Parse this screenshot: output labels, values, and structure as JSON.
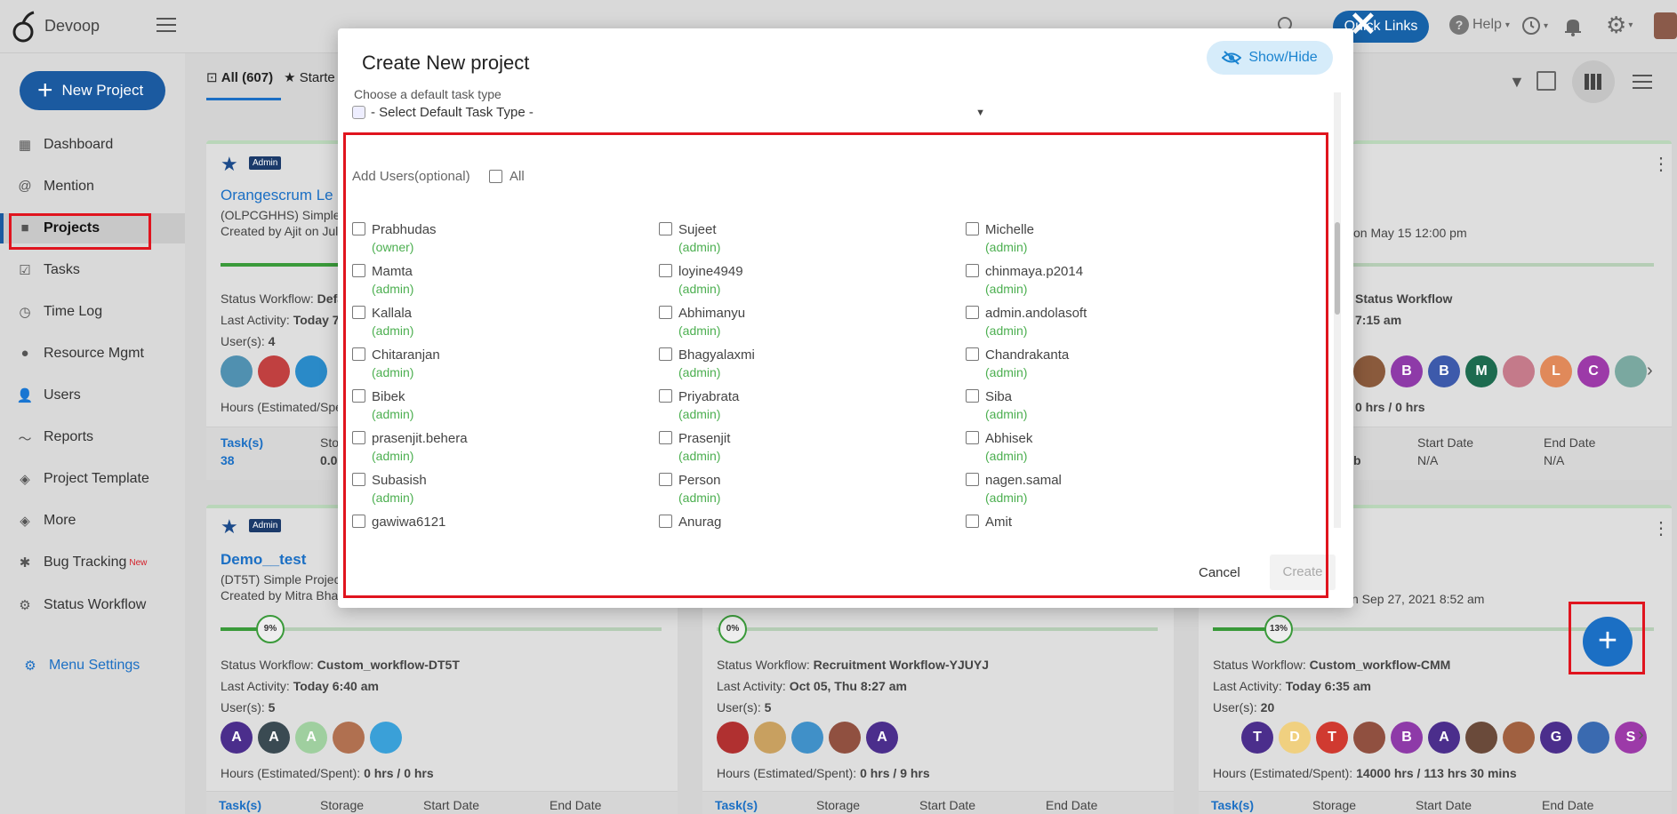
{
  "app": {
    "brand": "Devoop"
  },
  "topbar": {
    "quick_links": "Quick Links",
    "help": "Help"
  },
  "sidebar": {
    "new_project": "New Project",
    "items": [
      {
        "label": "Dashboard",
        "icon": "dashboard-icon"
      },
      {
        "label": "Mention",
        "icon": "at-icon"
      },
      {
        "label": "Projects",
        "icon": "briefcase-icon"
      },
      {
        "label": "Tasks",
        "icon": "clipboard-icon"
      },
      {
        "label": "Time Log",
        "icon": "clock-icon"
      },
      {
        "label": "Resource Mgmt",
        "icon": "resource-icon"
      },
      {
        "label": "Users",
        "icon": "user-icon"
      },
      {
        "label": "Reports",
        "icon": "chart-line-icon"
      },
      {
        "label": "Project Template",
        "icon": "layers-icon"
      },
      {
        "label": "More",
        "icon": "layers-icon"
      },
      {
        "label": "Bug Tracking",
        "icon": "bug-icon",
        "badge": "New"
      },
      {
        "label": "Status Workflow",
        "icon": "workflow-icon"
      }
    ],
    "menu_settings": "Menu Settings"
  },
  "content": {
    "tab_all": "All (607)",
    "tab_starred": "Starte"
  },
  "cards": {
    "card1": {
      "badge": "Admin",
      "title": "Orangescrum Le",
      "sub": "(OLPCGHHS) Simple",
      "created": "Created by Ajit on Jul",
      "workflow_label": "Status Workflow:",
      "workflow": "Defa",
      "activity_label": "Last Activity:",
      "activity": "Today 7",
      "users_label": "User(s):",
      "users": "4",
      "hours_label": "Hours (Estimated/Spe",
      "tasks_label": "Task(s)",
      "tasks": "38",
      "storage_label": "Sto",
      "storage": "0.0"
    },
    "card3": {
      "created": "on May 15 12:00 pm",
      "workflow": "Status Workflow",
      "activity": "7:15 am",
      "hours": "0 hrs / 0 hrs",
      "storage": "b",
      "start_label": "Start Date",
      "start": "N/A",
      "end_label": "End Date",
      "end": "N/A"
    },
    "card4": {
      "badge": "Admin",
      "title": "Demo__test",
      "sub": "(DT5T) Simple Projec",
      "created": "Created by Mitra Bhar",
      "progress": "9%",
      "workflow_label": "Status Workflow:",
      "workflow": "Custom_workflow-DT5T",
      "activity_label": "Last Activity:",
      "activity": "Today 6:40 am",
      "users_label": "User(s):",
      "users": "5",
      "hours_label": "Hours (Estimated/Spent):",
      "hours": "0 hrs / 0 hrs",
      "tasks_label": "Task(s)",
      "storage_label": "Storage",
      "start_label": "Start Date",
      "end_label": "End Date"
    },
    "card5": {
      "progress": "0%",
      "workflow_label": "Status Workflow:",
      "workflow": "Recruitment Workflow-YJUYJ",
      "activity_label": "Last Activity:",
      "activity": "Oct 05, Thu 8:27 am",
      "users_label": "User(s):",
      "users": "5",
      "hours_label": "Hours (Estimated/Spent):",
      "hours": "0 hrs / 9 hrs",
      "tasks_label": "Task(s)",
      "storage_label": "Storage",
      "start_label": "Start Date",
      "end_label": "End Date"
    },
    "card6": {
      "created": "n Sep 27, 2021 8:52 am",
      "progress": "13%",
      "workflow_label": "Status Workflow:",
      "workflow": "Custom_workflow-CMM",
      "activity_label": "Last Activity:",
      "activity": "Today 6:35 am",
      "users_label": "User(s):",
      "users": "20",
      "hours_label": "Hours (Estimated/Spent):",
      "hours": "14000 hrs / 113 hrs 30 mins",
      "tasks_label": "Task(s)",
      "storage_label": "Storage",
      "start_label": "Start Date",
      "end_label": "End Date"
    }
  },
  "modal": {
    "title": "Create New project",
    "show_hide": "Show/Hide",
    "task_type_label": "Choose a default task type",
    "task_type_select": "- Select Default Task Type -",
    "add_users": "Add Users(optional)",
    "all": "All",
    "users": [
      {
        "name": "Prabhudas",
        "role": "(owner)"
      },
      {
        "name": "Sujeet",
        "role": "(admin)"
      },
      {
        "name": "Michelle",
        "role": "(admin)"
      },
      {
        "name": "Mamta",
        "role": "(admin)"
      },
      {
        "name": "loyine4949",
        "role": "(admin)"
      },
      {
        "name": "chinmaya.p2014",
        "role": "(admin)"
      },
      {
        "name": "Kallala",
        "role": "(admin)"
      },
      {
        "name": "Abhimanyu",
        "role": "(admin)"
      },
      {
        "name": "admin.andolasoft",
        "role": "(admin)"
      },
      {
        "name": "Chitaranjan",
        "role": "(admin)"
      },
      {
        "name": "Bhagyalaxmi",
        "role": "(admin)"
      },
      {
        "name": "Chandrakanta",
        "role": "(admin)"
      },
      {
        "name": "Bibek",
        "role": "(admin)"
      },
      {
        "name": "Priyabrata",
        "role": "(admin)"
      },
      {
        "name": "Siba",
        "role": "(admin)"
      },
      {
        "name": "prasenjit.behera",
        "role": "(admin)"
      },
      {
        "name": "Prasenjit",
        "role": "(admin)"
      },
      {
        "name": "Abhisek",
        "role": "(admin)"
      },
      {
        "name": "Subasish",
        "role": "(admin)"
      },
      {
        "name": "Person",
        "role": "(admin)"
      },
      {
        "name": "nagen.samal",
        "role": "(admin)"
      },
      {
        "name": "gawiwa6121",
        "role": ""
      },
      {
        "name": "Anurag",
        "role": ""
      },
      {
        "name": "Amit",
        "role": ""
      }
    ],
    "cancel": "Cancel",
    "create": "Create"
  },
  "avatars": {
    "card3": [
      {
        "letter": "",
        "color": "#8a5a3c"
      },
      {
        "letter": "B",
        "color": "#8e3aa8"
      },
      {
        "letter": "B",
        "color": "#3d5aab"
      },
      {
        "letter": "M",
        "color": "#1d6b4f"
      },
      {
        "letter": "",
        "color": "#c47a8a"
      },
      {
        "letter": "L",
        "color": "#e0895a"
      },
      {
        "letter": "C",
        "color": "#9c3aa8"
      },
      {
        "letter": "",
        "color": "#7aa8a0"
      }
    ],
    "card4": [
      {
        "letter": "A",
        "color": "#4b2e8c"
      },
      {
        "letter": "A",
        "color": "#3a4a52"
      },
      {
        "letter": "A",
        "color": "#9fcf9f"
      },
      {
        "letter": "",
        "color": "#b07050"
      },
      {
        "letter": "",
        "color": "#3aa0d8"
      }
    ],
    "card5": [
      {
        "letter": "",
        "color": "#b03030"
      },
      {
        "letter": "",
        "color": "#c8a060"
      },
      {
        "letter": "",
        "color": "#4090c8"
      },
      {
        "letter": "",
        "color": "#905040"
      },
      {
        "letter": "A",
        "color": "#4b2e8c"
      }
    ],
    "card6": [
      {
        "letter": "T",
        "color": "#4b2e8c"
      },
      {
        "letter": "D",
        "color": "#f0d080"
      },
      {
        "letter": "T",
        "color": "#d03a30"
      },
      {
        "letter": "",
        "color": "#905040"
      },
      {
        "letter": "B",
        "color": "#8e3aa8"
      },
      {
        "letter": "A",
        "color": "#4b2e8c"
      },
      {
        "letter": "",
        "color": "#6a4a3a"
      },
      {
        "letter": "",
        "color": "#a06040"
      },
      {
        "letter": "G",
        "color": "#4b2e8c"
      },
      {
        "letter": "",
        "color": "#3a6ab0"
      },
      {
        "letter": "S",
        "color": "#9c3aa8"
      }
    ],
    "card1": [
      {
        "letter": "",
        "color": "#5090b0"
      },
      {
        "letter": "",
        "color": "#c04040"
      },
      {
        "letter": "",
        "color": "#2a8ac8"
      }
    ]
  }
}
